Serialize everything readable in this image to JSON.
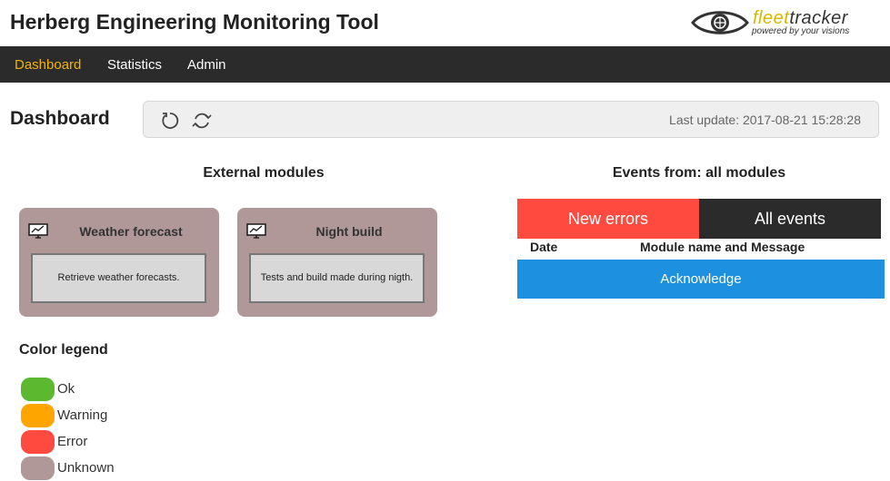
{
  "header": {
    "title": "Herberg Engineering Monitoring Tool",
    "logo": {
      "brand_light": "fleet",
      "brand_dark": "tracker",
      "tagline": "powered by your visions",
      "accent": "#d4b800"
    }
  },
  "nav": {
    "items": [
      {
        "label": "Dashboard",
        "active": true
      },
      {
        "label": "Statistics",
        "active": false
      },
      {
        "label": "Admin",
        "active": false
      }
    ],
    "background": "#2b2b2b",
    "active_color": "#f0b400"
  },
  "dashboard": {
    "title": "Dashboard",
    "toolbar": {
      "icons": [
        "refresh-icon",
        "sync-icon"
      ],
      "last_update": "Last update: 2017-08-21 15:28:28"
    }
  },
  "external_modules": {
    "title": "External modules",
    "modules": [
      {
        "title": "Weather forecast",
        "description": "Retrieve weather forecasts.",
        "icon": "monitor-chart-icon",
        "status_color": "#b09899"
      },
      {
        "title": "Night build",
        "description": "Tests and build made during nigth.",
        "icon": "monitor-chart-icon",
        "status_color": "#b09899"
      }
    ]
  },
  "legend": {
    "title": "Color legend",
    "items": [
      {
        "label": "Ok",
        "color": "#5cb82f"
      },
      {
        "label": "Warning",
        "color": "#ffa500"
      },
      {
        "label": "Error",
        "color": "#ff4a40"
      },
      {
        "label": "Unknown",
        "color": "#b09899"
      }
    ]
  },
  "events": {
    "title": "Events from: all modules",
    "tabs": [
      {
        "label": "New errors",
        "color": "#ff4a40"
      },
      {
        "label": "All events",
        "color": "#2b2b2b"
      }
    ],
    "columns": [
      "Date",
      "Module name and Message"
    ],
    "acknowledge_label": "Acknowledge",
    "acknowledge_color": "#1e90e0"
  }
}
